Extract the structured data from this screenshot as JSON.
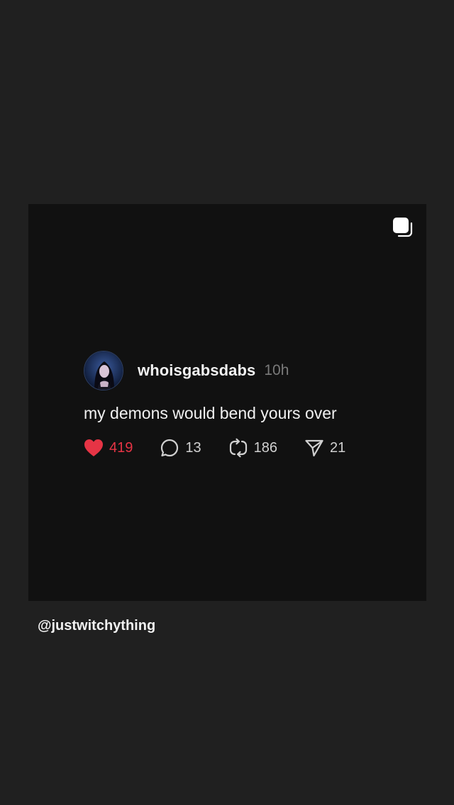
{
  "post": {
    "username": "whoisgabsdabs",
    "time": "10h",
    "text": "my demons would bend yours over",
    "likes": "419",
    "comments": "13",
    "reposts": "186",
    "shares": "21"
  },
  "footer": {
    "handle": "@justwitchything"
  },
  "icons": {
    "stack": "stack-icon",
    "like": "heart-icon",
    "comment": "comment-icon",
    "repost": "repost-icon",
    "share": "send-icon"
  },
  "colors": {
    "background": "#202020",
    "card": "#111111",
    "like_accent": "#e63445",
    "text_primary": "#f0f0f0",
    "text_muted": "#7a7a7a"
  }
}
